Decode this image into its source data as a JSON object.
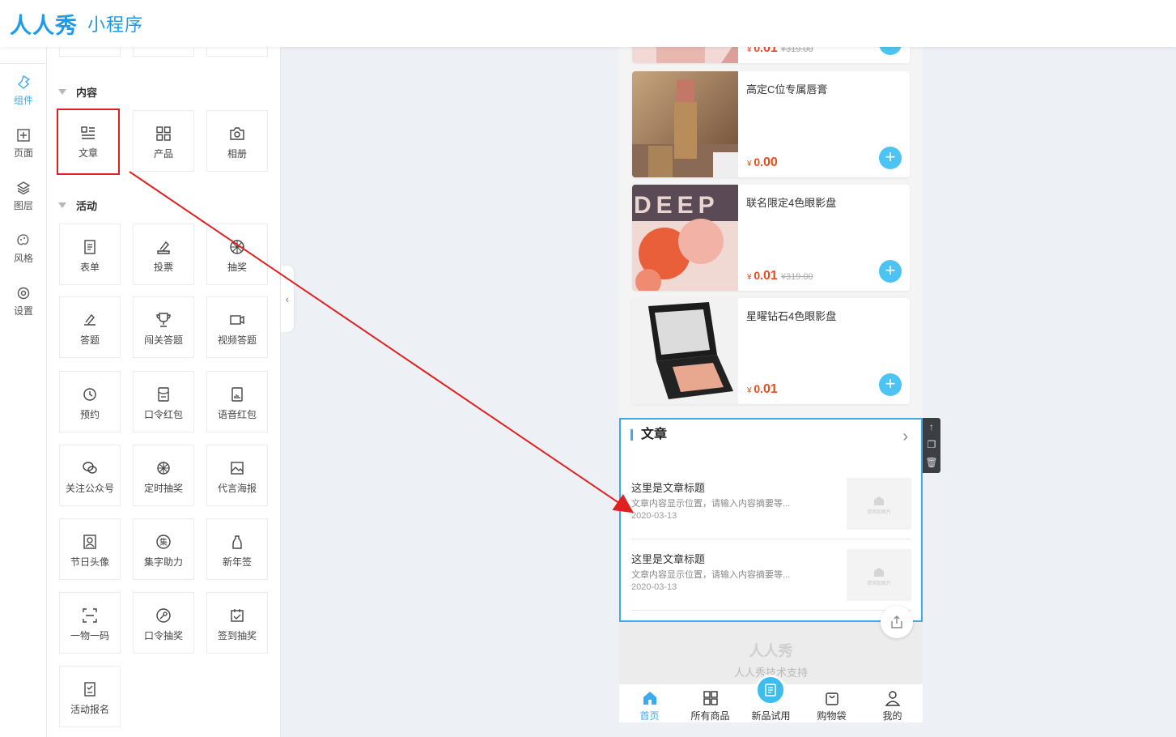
{
  "header": {
    "brand": "人人秀",
    "sub": "小程序"
  },
  "rail": [
    {
      "label": "组件",
      "icon": "component-icon",
      "active": true
    },
    {
      "label": "页面",
      "icon": "page-plus-icon"
    },
    {
      "label": "图层",
      "icon": "layers-icon"
    },
    {
      "label": "风格",
      "icon": "palette-icon"
    },
    {
      "label": "设置",
      "icon": "settings-icon"
    }
  ],
  "panel": {
    "content_title": "内容",
    "content_items": [
      {
        "label": "文章",
        "icon": "article-icon"
      },
      {
        "label": "产品",
        "icon": "grid-icon"
      },
      {
        "label": "相册",
        "icon": "camera-icon"
      }
    ],
    "activity_title": "活动",
    "activity_items": [
      {
        "label": "表单",
        "icon": "form-icon"
      },
      {
        "label": "投票",
        "icon": "vote-icon"
      },
      {
        "label": "抽奖",
        "icon": "lottery-wheel-icon"
      },
      {
        "label": "答题",
        "icon": "quiz-icon"
      },
      {
        "label": "闯关答题",
        "icon": "trophy-icon"
      },
      {
        "label": "视频答题",
        "icon": "video-icon"
      },
      {
        "label": "预约",
        "icon": "clock-icon"
      },
      {
        "label": "口令红包",
        "icon": "red-envelope-icon"
      },
      {
        "label": "语音红包",
        "icon": "voice-envelope-icon"
      },
      {
        "label": "关注公众号",
        "icon": "wechat-icon"
      },
      {
        "label": "定时抽奖",
        "icon": "timed-lottery-icon"
      },
      {
        "label": "代言海报",
        "icon": "poster-icon"
      },
      {
        "label": "节日头像",
        "icon": "avatar-frame-icon"
      },
      {
        "label": "集字助力",
        "icon": "collect-word-icon"
      },
      {
        "label": "新年签",
        "icon": "new-year-sign-icon"
      },
      {
        "label": "一物一码",
        "icon": "scan-code-icon"
      },
      {
        "label": "口令抽奖",
        "icon": "key-lottery-icon"
      },
      {
        "label": "签到抽奖",
        "icon": "checkin-icon"
      },
      {
        "label": "活动报名",
        "icon": "signup-icon"
      }
    ]
  },
  "preview": {
    "products": [
      {
        "name": "",
        "currency": "¥",
        "price_int": "0.",
        "price_dec": "01",
        "orig": "¥319.00",
        "img": "perfume"
      },
      {
        "name": "高定C位专属唇膏",
        "currency": "¥",
        "price_int": "0.",
        "price_dec": "00",
        "orig": "",
        "img": "lipstick"
      },
      {
        "name": "联名限定4色眼影盘",
        "currency": "¥",
        "price_int": "0.",
        "price_dec": "01",
        "orig": "¥319.00",
        "img": "eyeshadow"
      },
      {
        "name": "星曜钻石4色眼影盘",
        "currency": "¥",
        "price_int": "0.",
        "price_dec": "01",
        "orig": "",
        "img": "palette"
      }
    ],
    "article_block": {
      "title": "文章",
      "items": [
        {
          "title": "这里是文章标题",
          "desc": "文章内容显示位置，请输入内容摘要等...",
          "date": "2020-03-13",
          "thumb": "请添加图片"
        },
        {
          "title": "这里是文章标题",
          "desc": "文章内容显示位置，请输入内容摘要等...",
          "date": "2020-03-13",
          "thumb": "请添加图片"
        }
      ]
    },
    "support": {
      "logo": "人人秀",
      "text": "人人秀技术支持"
    },
    "tabs": [
      {
        "label": "首页",
        "icon": "home-icon",
        "active": true
      },
      {
        "label": "所有商品",
        "icon": "grid-icon"
      },
      {
        "label": "新品试用",
        "icon": "new-product-icon"
      },
      {
        "label": "购物袋",
        "icon": "bag-icon"
      },
      {
        "label": "我的",
        "icon": "user-icon"
      }
    ]
  },
  "colors": {
    "accent": "#3ca9f0",
    "price": "#f04a1c",
    "highlight": "#e02020",
    "add_button": "#4cc3f2"
  }
}
